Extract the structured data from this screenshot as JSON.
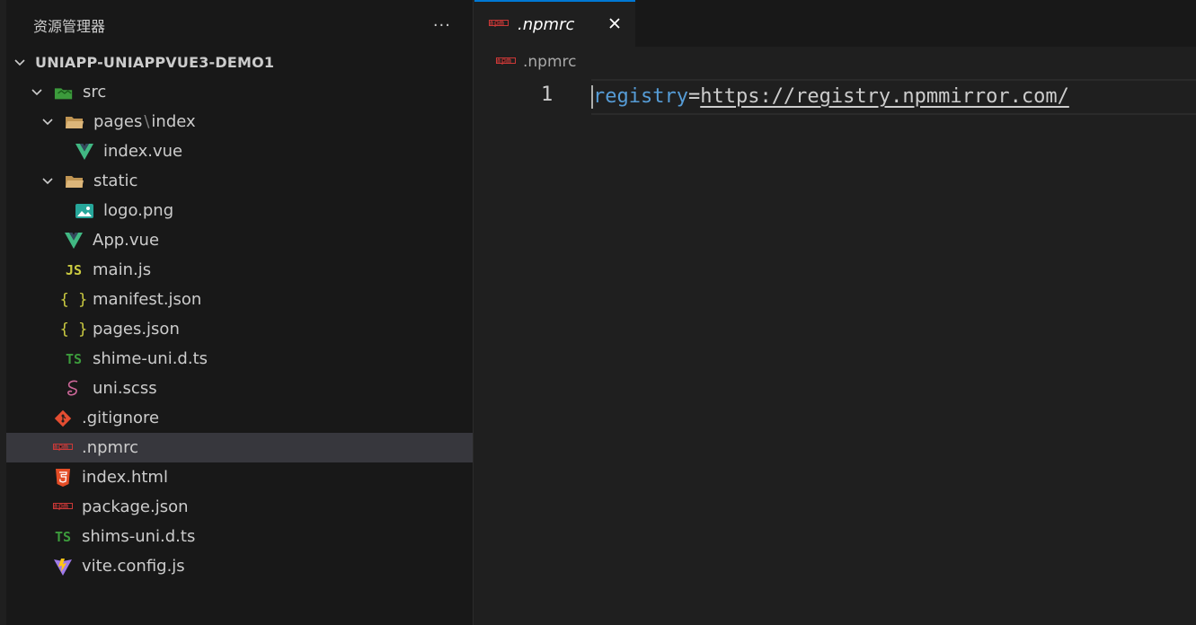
{
  "explorer": {
    "title": "资源管理器",
    "more_label": "···",
    "root": {
      "label": "UNIAPP-UNIAPPVUE3-DEMO1"
    },
    "src": {
      "label": "src"
    },
    "pages": {
      "label": "pages",
      "separator": "\\",
      "sub": "index"
    },
    "static": {
      "label": "static"
    },
    "files": {
      "index_vue": "index.vue",
      "logo_png": "logo.png",
      "app_vue": "App.vue",
      "main_js": "main.js",
      "manifest_json": "manifest.json",
      "pages_json": "pages.json",
      "shime_uni_dts": "shime-uni.d.ts",
      "uni_scss": "uni.scss",
      "gitignore": ".gitignore",
      "npmrc": ".npmrc",
      "index_html": "index.html",
      "package_json": "package.json",
      "shims_uni_dts": "shims-uni.d.ts",
      "vite_config_js": "vite.config.js"
    },
    "icon_text": {
      "js": "JS",
      "ts": "TS",
      "json": "{ }"
    },
    "selected_item": ".npmrc"
  },
  "editor": {
    "tab": {
      "label": ".npmrc",
      "close_label": "✕"
    },
    "breadcrumb": ".npmrc",
    "lines": [
      {
        "number": "1",
        "key": "registry",
        "eq": "=",
        "value": "https://registry.npmmirror.com/"
      }
    ]
  },
  "colors": {
    "accent": "#0078d4",
    "sidebar_bg": "#181818",
    "editor_bg": "#1f1f1f",
    "selection_bg": "#37373d",
    "vue_green": "#41b883",
    "js_yellow": "#cbcb41",
    "ts_green": "#3c9b3c",
    "npm_red": "#cb3837",
    "folder_tan": "#c09553",
    "key_blue": "#569cd6"
  },
  "icons": {
    "chevron": "chevron-down-icon",
    "src_folder": "folder-src-icon",
    "folder": "folder-open-icon",
    "vue": "vue-icon",
    "image": "image-icon",
    "js": "js-icon",
    "json": "json-icon",
    "ts": "ts-icon",
    "scss": "sass-icon",
    "git": "git-icon",
    "npm": "npm-icon",
    "html": "html5-icon",
    "vite": "vite-icon"
  }
}
